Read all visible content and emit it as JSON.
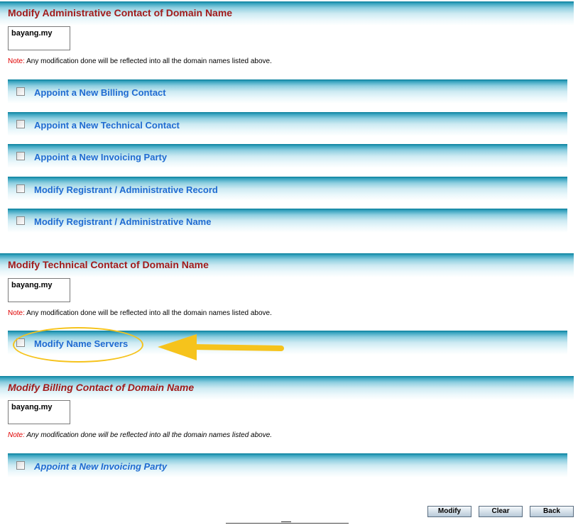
{
  "sections": {
    "admin": {
      "title": "Modify Administrative Contact of Domain Name",
      "domain": "bayang.my",
      "note_label": "Note:",
      "note_text": " Any modification done will be reflected into all the domain names listed above.",
      "options": [
        "Appoint a New Billing Contact",
        "Appoint a New Technical Contact",
        "Appoint a New Invoicing Party",
        "Modify Registrant / Administrative Record",
        "Modify Registrant / Administrative Name"
      ]
    },
    "technical": {
      "title": "Modify Technical Contact of Domain Name",
      "domain": "bayang.my",
      "note_label": "Note:",
      "note_text": " Any modification done will be reflected into all the domain names listed above.",
      "options": [
        "Modify Name Servers"
      ]
    },
    "billing": {
      "title": "Modify Billing Contact of Domain Name",
      "domain": "bayang.my",
      "note_label": "Note:",
      "note_text": " Any modification done will be reflected into all the domain names listed above.",
      "options": [
        "Appoint a New Invoicing Party"
      ]
    }
  },
  "buttons": {
    "modify": "Modify",
    "clear": "Clear",
    "back": "Back"
  },
  "colors": {
    "title": "#a11b1b",
    "option_label": "#1f6bd1",
    "note_label": "#e00000",
    "header_band": "#0a7f9c",
    "annotation": "#f6c31c"
  },
  "annotation": {
    "highlight_ellipse_icon": "highlight-ellipse",
    "pointer_arrow_icon": "arrow-left-icon"
  }
}
